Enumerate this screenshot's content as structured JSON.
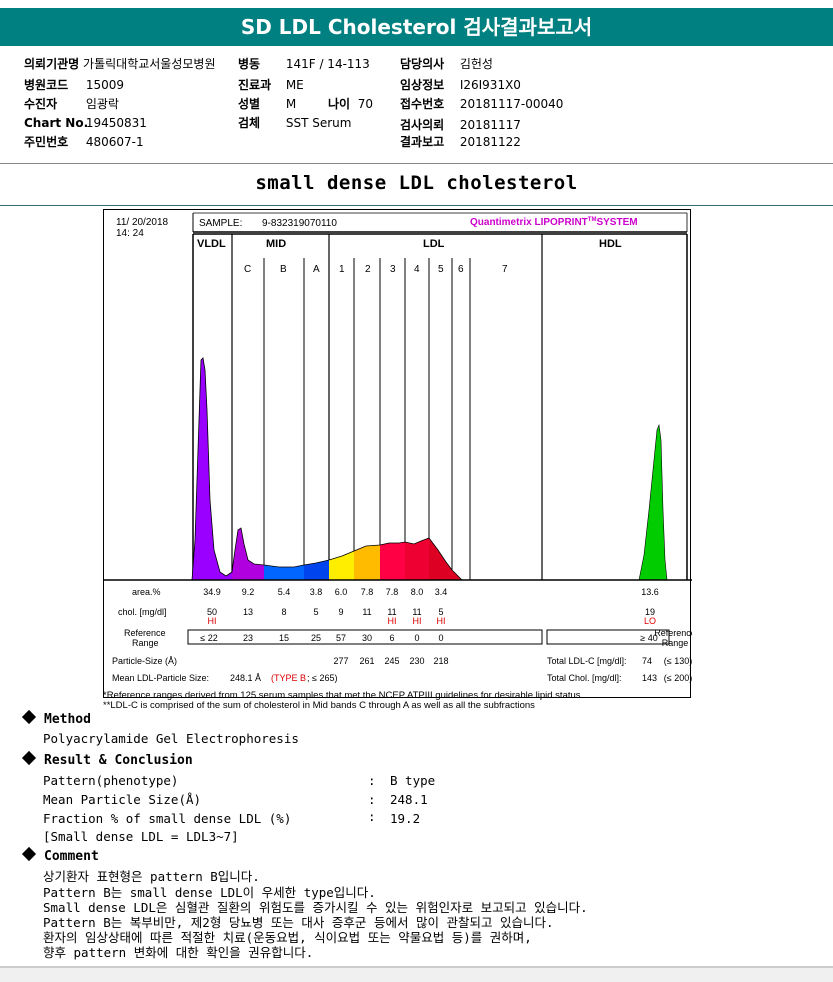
{
  "title": "SD LDL Cholesterol 검사결과보고서",
  "info": {
    "col1": [
      {
        "label": "의뢰기관명",
        "value": "가톨릭대학교서울성모병원"
      },
      {
        "label": "병원코드",
        "value": "15009"
      },
      {
        "label": "수진자",
        "value": "임광락"
      },
      {
        "label": "Chart No.",
        "value": "19450831"
      },
      {
        "label": "주민번호",
        "value": "480607-1"
      }
    ],
    "col2": [
      {
        "label": "병동",
        "value": "141F / 14-113"
      },
      {
        "label": "진료과",
        "value": "ME"
      },
      {
        "label": "성별",
        "value": "M"
      },
      {
        "label": "검체",
        "value": "SST Serum"
      }
    ],
    "age": {
      "label": "나이",
      "value": "70"
    },
    "col3": [
      {
        "label": "담당의사",
        "value": "김헌성"
      },
      {
        "label": "임상정보",
        "value": "I26I931X0"
      },
      {
        "label": "접수번호",
        "value": "20181117-00040"
      },
      {
        "label": "검사의뢰",
        "value": "20181117"
      },
      {
        "label": "결과보고",
        "value": "20181122"
      }
    ]
  },
  "section_title": "small dense LDL cholesterol",
  "report": {
    "date": "11/ 20/2018",
    "time": "14: 24",
    "sample_label": "SAMPLE:",
    "sample_id": "9-832319070110",
    "brand": "Quantimetrix LIPOPRINT",
    "brand_tm": "TM",
    "brand_suffix": "SYSTEM",
    "group_vldl": "VLDL",
    "group_mid": "MID",
    "group_ldl": "LDL",
    "group_hdl": "HDL",
    "subbands": [
      "C",
      "B",
      "A",
      "1",
      "2",
      "3",
      "4",
      "5",
      "6",
      "7"
    ],
    "row_area_label": "area.%",
    "row_chol_label": "chol. [mg/dl]",
    "row_ref_label": "Reference Range",
    "ref_label_right": "Reference Range",
    "area": [
      "34.9",
      "9.2",
      "5.4",
      "3.8",
      "6.0",
      "7.8",
      "7.8",
      "8.0",
      "3.4"
    ],
    "area_hdl": "13.6",
    "chol": [
      "50",
      "13",
      "8",
      "5",
      "9",
      "11",
      "11",
      "11",
      "5"
    ],
    "chol_flags": [
      "HI",
      "",
      "",
      "",
      "",
      "",
      "HI",
      "HI",
      "HI"
    ],
    "chol_hdl": "19",
    "chol_hdl_flag": "LO",
    "ref": [
      "≤ 22",
      "23",
      "15",
      "25",
      "57",
      "30",
      "6",
      "0",
      "0"
    ],
    "ref_hdl": "≥ 40",
    "particle_label": "Particle-Size (Å)",
    "particle": [
      "277",
      "261",
      "245",
      "230",
      "218"
    ],
    "total_ldl_label": "Total LDL-C [mg/dl]:",
    "total_ldl_value": "74",
    "total_ldl_ref": "(≤ 130)",
    "mean_label": "Mean LDL-Particle Size:",
    "mean_value": "248.1 Å",
    "mean_type": "(TYPE B",
    "mean_ref": "; ≤ 265)",
    "total_chol_label": "Total Chol. [mg/dl]:",
    "total_chol_value": "143",
    "total_chol_ref": "(≤ 200)",
    "colors": {
      "vldl": "#9900ff",
      "c": "#b000e0",
      "b": "#0066ff",
      "a": "#0044ee",
      "l1": "#ffee00",
      "l2": "#ffbb00",
      "l3": "#ff0044",
      "l4": "#ee0033",
      "l5": "#dd0022",
      "hdl": "#00cc00",
      "brand": "#cc00cc",
      "flag": "#dd0000"
    }
  },
  "footnotes": [
    "*Reference ranges derived from 125 serum samples that met the NCEP ATPIII guidelines for desirable lipid status",
    "**LDL-C is comprised of the sum of cholesterol in Mid bands C through A as well as all the subfractions"
  ],
  "method": {
    "heading": "Method",
    "text": "Polyacrylamide Gel Electrophoresis"
  },
  "result": {
    "heading": "Result & Conclusion",
    "rows": [
      {
        "label": "Pattern(phenotype)",
        "value": "B type"
      },
      {
        "label": "Mean Particle Size(Å)",
        "value": "248.1"
      },
      {
        "label": "Fraction % of small dense LDL (%)",
        "value": "19.2"
      }
    ],
    "note": "[Small dense LDL = LDL3~7]"
  },
  "comment": {
    "heading": "Comment",
    "lines": [
      "상기환자 표현형은 pattern B입니다.",
      "Pattern B는 small dense LDL이 우세한 type입니다.",
      "Small dense LDL은 심혈관 질환의 위험도를 증가시킬 수 있는 위험인자로 보고되고 있습니다.",
      "Pattern B는 복부비만, 제2형 당뇨병 또는 대사 증후군 등에서 많이 관찰되고 있습니다.",
      "환자의 임상상태에 따른 적절한 치료(운동요법, 식이요법 또는 약물요법 등)를 권하며,",
      "향후 pattern 변화에 대한 확인을 권유합니다."
    ]
  }
}
